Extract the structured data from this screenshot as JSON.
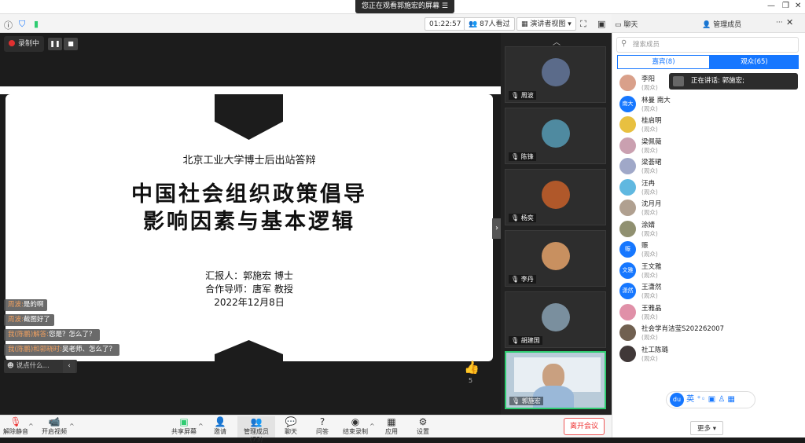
{
  "window": {
    "viewing_banner": "您正在观看郭施宏的屏幕",
    "controls": [
      "—",
      "❐",
      "✕"
    ]
  },
  "toolbar": {
    "timer": "01:22:57",
    "viewers": "87人看过",
    "view_mode": "演讲者视图"
  },
  "recording": {
    "label": "录制中"
  },
  "slide": {
    "subtitle": "北京工业大学博士后出站答辩",
    "title_line1": "中国社会组织政策倡导",
    "title_line2": "影响因素与基本逻辑",
    "reporter": "汇报人：郭施宏 博士",
    "advisor": "合作导师：唐军 教授",
    "date": "2022年12月8日"
  },
  "chat": {
    "messages": [
      {
        "name": "周波:",
        "text": "是的啊"
      },
      {
        "name": "周波:",
        "text": "截图好了"
      },
      {
        "name": "我(陈鹏)解答:",
        "text": "您是？怎么了？"
      },
      {
        "name": "我(陈鹏)和郭晓时:",
        "text": "吴老师、怎么了？"
      }
    ],
    "input_placeholder": "说点什么..."
  },
  "likes": {
    "count": "5"
  },
  "video_tiles": [
    {
      "name": "周波",
      "color": "#5b6b8a"
    },
    {
      "name": "陈锋",
      "color": "#4f8aa0"
    },
    {
      "name": "杨奕",
      "color": "#b0582a"
    },
    {
      "name": "李丹",
      "color": "#c89060"
    },
    {
      "name": "胡建国",
      "color": "#7a8f9e"
    }
  ],
  "self_video": {
    "name": "郭施宏"
  },
  "right_panel": {
    "tab_chat": "聊天",
    "tab_members": "管理成员",
    "search_placeholder": "搜索成员",
    "seg_guests": "嘉宾(8)",
    "seg_audience": "观众(65)",
    "speaking": "正在讲话: 郭施宏;",
    "more": "更多",
    "members": [
      {
        "name": "李阳",
        "role": "(观众)",
        "avatar": "",
        "color": "#d9a08a"
      },
      {
        "name": "林曼 南大",
        "role": "(观众)",
        "avatar": "南大",
        "color": "#1677ff"
      },
      {
        "name": "桂启明",
        "role": "(观众)",
        "avatar": "",
        "color": "#e8c040"
      },
      {
        "name": "梁佩薇",
        "role": "(观众)",
        "avatar": "",
        "color": "#caa0b0"
      },
      {
        "name": "梁荟珺",
        "role": "(观众)",
        "avatar": "",
        "color": "#a0a8c8"
      },
      {
        "name": "汪冉",
        "role": "(观众)",
        "avatar": "",
        "color": "#60b8e0"
      },
      {
        "name": "沈月月",
        "role": "(观众)",
        "avatar": "",
        "color": "#b0a090"
      },
      {
        "name": "涂婧",
        "role": "(观众)",
        "avatar": "",
        "color": "#909070"
      },
      {
        "name": "赈",
        "role": "(观众)",
        "avatar": "赈",
        "color": "#1677ff"
      },
      {
        "name": "王文雅",
        "role": "(观众)",
        "avatar": "文雅",
        "color": "#1677ff"
      },
      {
        "name": "王潇然",
        "role": "(观众)",
        "avatar": "潇然",
        "color": "#1677ff"
      },
      {
        "name": "王雅晶",
        "role": "(观众)",
        "avatar": "",
        "color": "#e090a8"
      },
      {
        "name": "社会学肖洁莹S202262007",
        "role": "(观众)",
        "avatar": "",
        "color": "#706050"
      },
      {
        "name": "社工陈璐",
        "role": "(观众)",
        "avatar": "",
        "color": "#403838"
      }
    ]
  },
  "bottom_bar": {
    "unmute": "解除静音",
    "start_video": "开启视频",
    "share": "共享屏幕",
    "invite": "邀请",
    "members": "管理成员(73)",
    "chat": "聊天",
    "qa": "问答",
    "end_record": "结束录制",
    "apps": "应用",
    "settings": "设置",
    "leave": "离开会议"
  }
}
